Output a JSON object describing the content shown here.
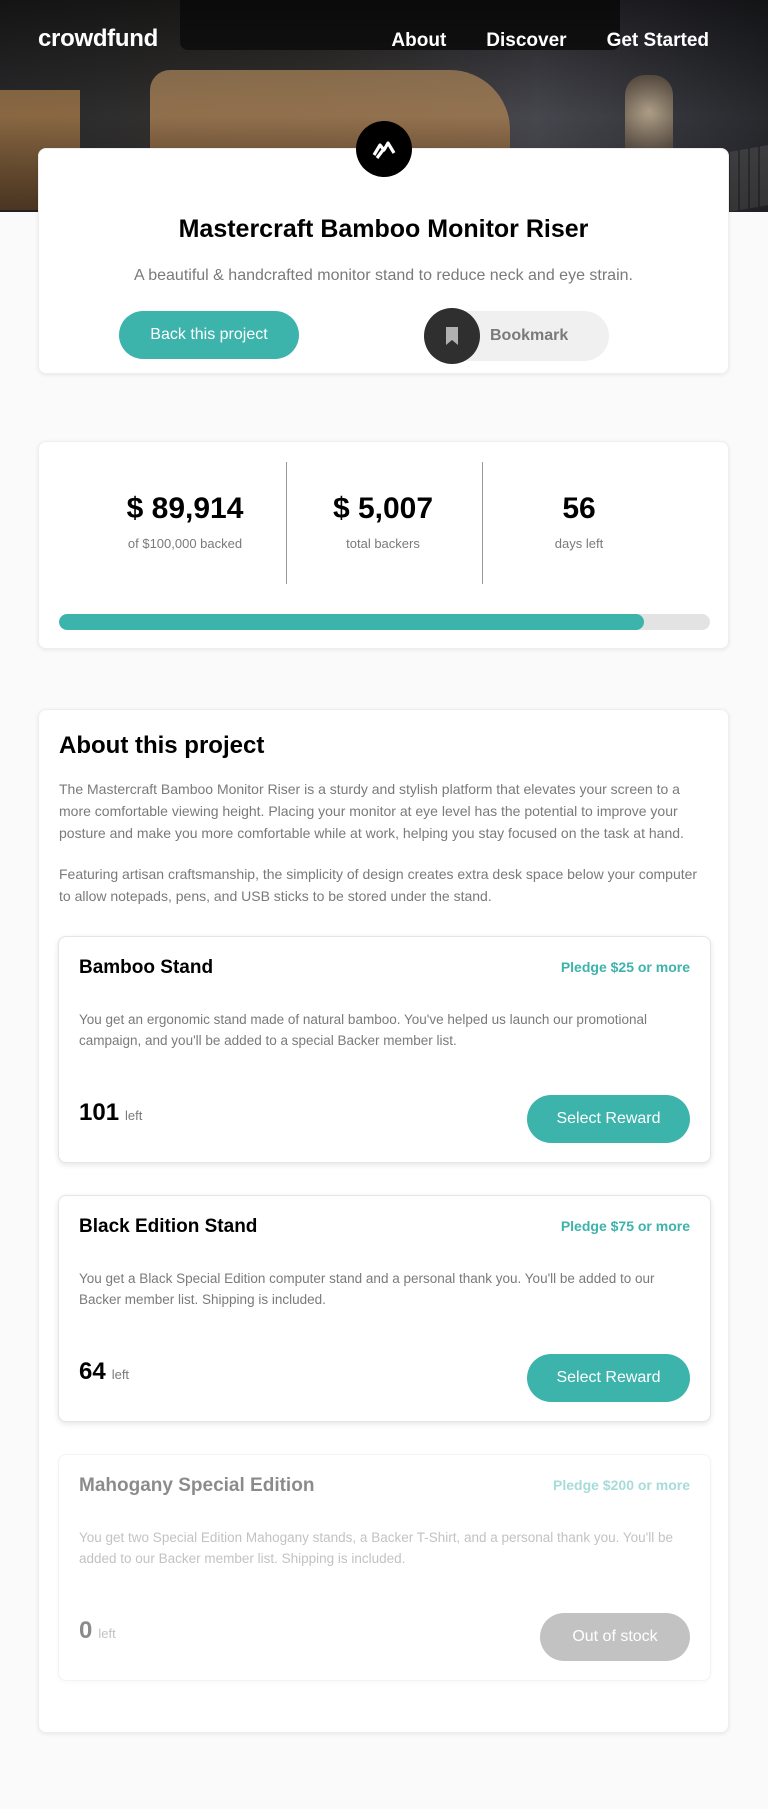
{
  "header": {
    "logo": "crowdfund",
    "nav": [
      "About",
      "Discover",
      "Get Started"
    ]
  },
  "project": {
    "icon": "mastercraft-logo-icon",
    "title": "Mastercraft Bamboo Monitor Riser",
    "subtitle": "A beautiful & handcrafted monitor stand to reduce neck and eye strain.",
    "back_label": "Back this project",
    "bookmark_label": "Bookmark"
  },
  "stats": {
    "backed": {
      "value": "$ 89,914",
      "label": "of $100,000 backed"
    },
    "backers": {
      "value": "$ 5,007",
      "label": "total backers"
    },
    "days": {
      "value": "56",
      "label": "days left"
    },
    "progress_fraction": 0.89914
  },
  "about": {
    "title": "About this project",
    "p1": "The Mastercraft Bamboo Monitor Riser is a sturdy and stylish platform that elevates your screen to a more comfortable viewing height. Placing your monitor at eye level has the potential to improve your posture and make you more comfortable while at work, helping you stay focused on the task at hand.",
    "p2": "Featuring artisan craftsmanship, the simplicity of design creates extra desk space below your computer to allow notepads, pens, and USB sticks to be stored under the stand.",
    "rewards": [
      {
        "name": "Bamboo Stand",
        "pledge": "Pledge $25 or more",
        "description": "You get an ergonomic stand made of natural bamboo. You've helped us launch our promotional campaign, and you'll be added to a special Backer member list.",
        "count": "101",
        "left_label": "left",
        "button": "Select Reward"
      },
      {
        "name": "Black Edition Stand",
        "pledge": "Pledge $75 or more",
        "description": "You get a Black Special Edition computer stand and a personal thank you. You'll be added to our Backer member list. Shipping is included.",
        "count": "64",
        "left_label": "left",
        "button": "Select Reward"
      },
      {
        "name": "Mahogany Special Edition",
        "pledge": "Pledge $200 or more",
        "description": "You get two Special Edition Mahogany stands, a Backer T-Shirt, and a personal thank you. You'll be added to our Backer member list. Shipping is included.",
        "count": "0",
        "left_label": "left",
        "button": "Out of stock"
      }
    ]
  },
  "colors": {
    "accent": "#3cb3ab",
    "dark": "#2f2f2f",
    "muted": "#7a7a7a"
  }
}
